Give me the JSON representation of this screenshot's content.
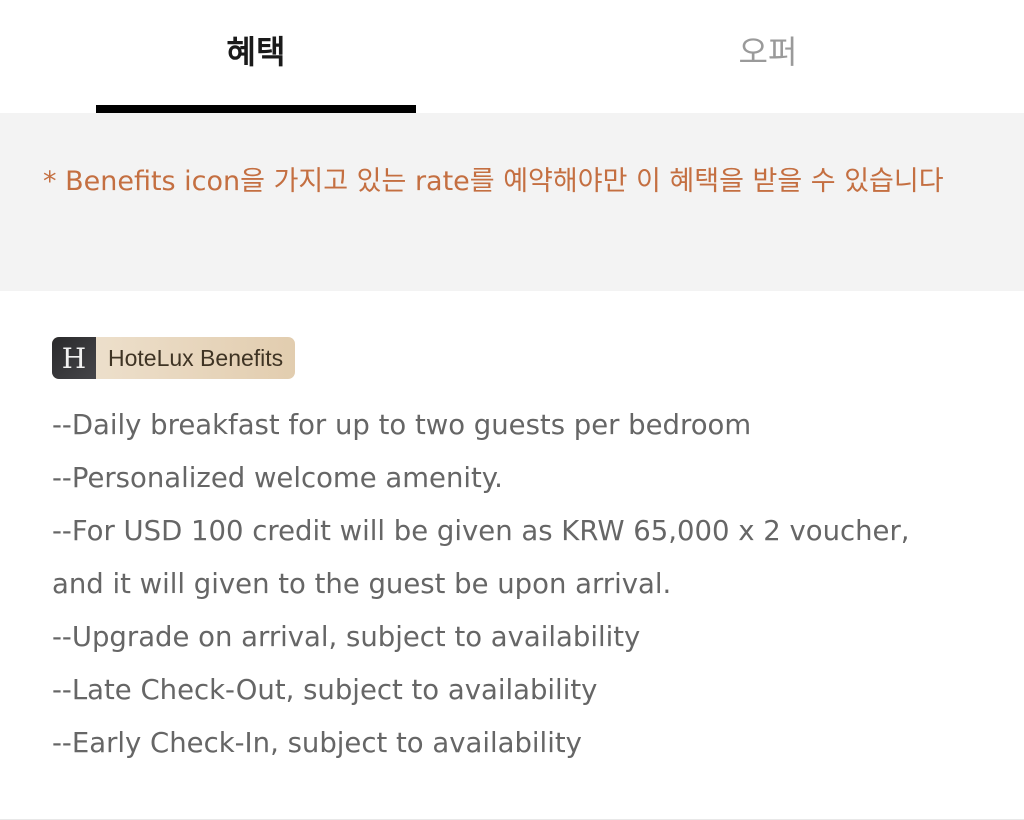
{
  "tabs": {
    "benefits_label": "혜택",
    "offers_label": "오퍼"
  },
  "notice": {
    "text": "* Benefits icon을 가지고 있는 rate를 예약해야만 이 혜택을 받을 수 있습니다"
  },
  "badge": {
    "logo_letter": "H",
    "label": "HoteLux Benefits"
  },
  "benefits": [
    "--Daily breakfast for up to two guests per bedroom",
    "--Personalized welcome amenity.",
    "--For USD 100 credit will be given as KRW 65,000 x 2 voucher,",
    "and it will given to the guest be upon arrival.",
    "--Upgrade on arrival, subject to availability",
    "--Late Check-Out, subject to availability",
    "--Early Check-In, subject to availability"
  ],
  "colors": {
    "notice_text": "#c46f41",
    "notice_bg": "#f3f3f3",
    "active_tab_indicator": "#000000",
    "inactive_tab_text": "#9a9a9a",
    "benefit_text": "#666666"
  }
}
